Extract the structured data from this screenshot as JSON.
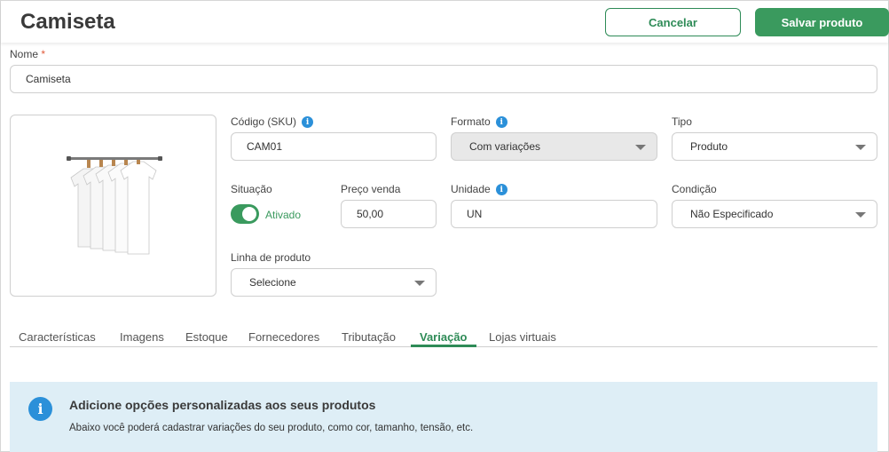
{
  "header": {
    "title": "Camiseta",
    "cancel_label": "Cancelar",
    "save_label": "Salvar produto"
  },
  "form": {
    "nome": {
      "label": "Nome",
      "required_mark": "*",
      "value": "Camiseta"
    },
    "codigo": {
      "label": "Código (SKU)",
      "value": "CAM01"
    },
    "formato": {
      "label": "Formato",
      "value": "Com variações"
    },
    "tipo": {
      "label": "Tipo",
      "value": "Produto"
    },
    "situacao": {
      "label": "Situação",
      "value": "Ativado",
      "enabled": true
    },
    "preco": {
      "label": "Preço venda",
      "value": "50,00"
    },
    "unidade": {
      "label": "Unidade",
      "value": "UN"
    },
    "condicao": {
      "label": "Condição",
      "value": "Não Especificado"
    },
    "linha": {
      "label": "Linha de produto",
      "value": "Selecione"
    }
  },
  "tabs": [
    {
      "label": "Características"
    },
    {
      "label": "Imagens"
    },
    {
      "label": "Estoque"
    },
    {
      "label": "Fornecedores"
    },
    {
      "label": "Tributação"
    },
    {
      "label": "Variação"
    },
    {
      "label": "Lojas virtuais"
    }
  ],
  "banner": {
    "title": "Adicione opções personalizadas aos seus produtos",
    "text": "Abaixo você poderá cadastrar variações do seu produto, como cor, tamanho, tensão, etc."
  },
  "icons": {
    "info": "info-icon",
    "caret": "chevron-down-icon",
    "product_image": "shirts-on-rack-image"
  },
  "colors": {
    "accent": "#3a9a5e",
    "info": "#2b90d9",
    "banner_bg": "#deeef6"
  }
}
